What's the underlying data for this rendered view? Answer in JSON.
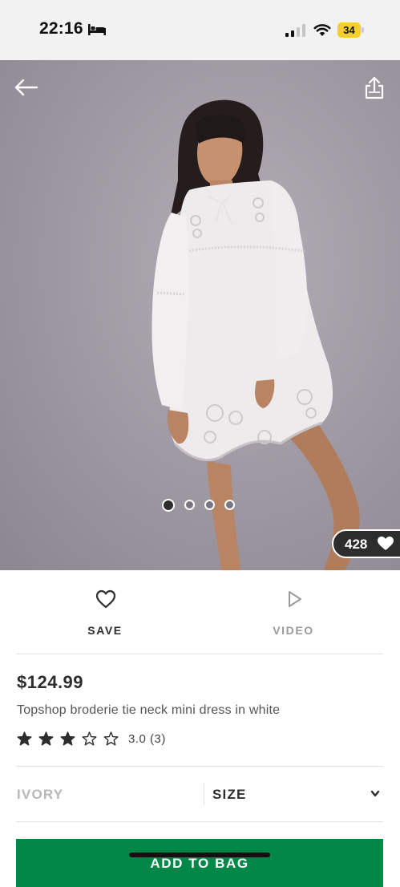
{
  "status_bar": {
    "time": "22:16",
    "battery_level": "34",
    "icons": [
      "bed-icon",
      "signal-icon",
      "wifi-icon",
      "battery-icon"
    ],
    "battery_color": "#f7cf2a"
  },
  "gallery": {
    "dot_count": 4,
    "active_dot": 0,
    "like_count": "428"
  },
  "actions": {
    "save_label": "SAVE",
    "video_label": "VIDEO"
  },
  "product": {
    "price": "$124.99",
    "name": "Topshop broderie tie neck mini dress in white",
    "rating_stars": 3,
    "rating_max": 5,
    "rating_text": "3.0  (3)"
  },
  "selectors": {
    "colour": "IVORY",
    "size_label": "SIZE"
  },
  "cta": {
    "add_to_bag_label": "ADD TO BAG",
    "color": "#018849"
  }
}
